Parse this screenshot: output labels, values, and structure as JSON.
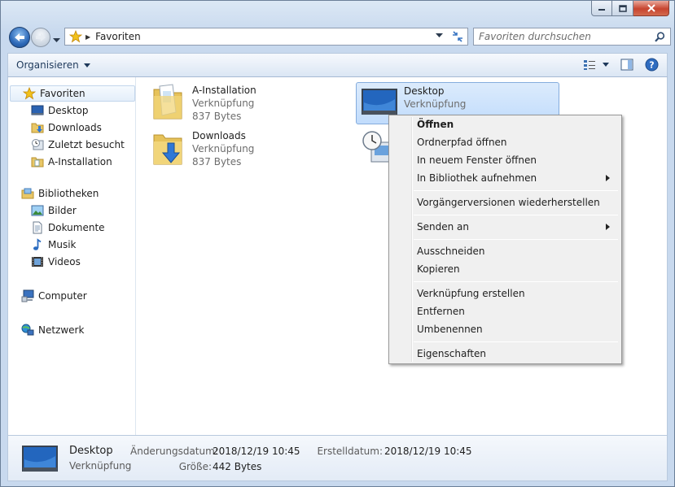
{
  "address": {
    "location": "Favoriten"
  },
  "search": {
    "placeholder": "Favoriten durchsuchen"
  },
  "toolbar": {
    "organize_label": "Organisieren"
  },
  "sidebar": {
    "favorites": {
      "label": "Favoriten",
      "items": [
        "Desktop",
        "Downloads",
        "Zuletzt besucht",
        "A-Installation"
      ]
    },
    "libraries": {
      "label": "Bibliotheken",
      "items": [
        "Bilder",
        "Dokumente",
        "Musik",
        "Videos"
      ]
    },
    "computer": {
      "label": "Computer"
    },
    "network": {
      "label": "Netzwerk"
    }
  },
  "files": [
    {
      "name": "A-Installation",
      "type": "Verknüpfung",
      "size": "837 Bytes"
    },
    {
      "name": "Downloads",
      "type": "Verknüpfung",
      "size": "837 Bytes"
    },
    {
      "name": "Desktop",
      "type": "Verknüpfung"
    }
  ],
  "context_menu": {
    "items": [
      {
        "label": "Öffnen",
        "bold": true
      },
      {
        "label": "Ordnerpfad öffnen"
      },
      {
        "label": "In neuem Fenster öffnen"
      },
      {
        "label": "In Bibliothek aufnehmen",
        "submenu": true
      },
      {
        "label": "Vorgängerversionen wiederherstellen"
      },
      {
        "label": "Senden an",
        "submenu": true
      },
      {
        "label": "Ausschneiden"
      },
      {
        "label": "Kopieren"
      },
      {
        "label": "Verknüpfung erstellen"
      },
      {
        "label": "Entfernen"
      },
      {
        "label": "Umbenennen"
      },
      {
        "label": "Eigenschaften"
      }
    ]
  },
  "details": {
    "name": "Desktop",
    "type": "Verknüpfung",
    "modified_label": "Änderungsdatum:",
    "modified_value": "2018/12/19 10:45",
    "created_label": "Erstelldatum:",
    "created_value": "2018/12/19 10:45",
    "size_label": "Größe:",
    "size_value": "442 Bytes"
  },
  "colors": {
    "accent": "#2d69b8",
    "selection": "#c1dcfc",
    "close_button": "#c7442f"
  }
}
